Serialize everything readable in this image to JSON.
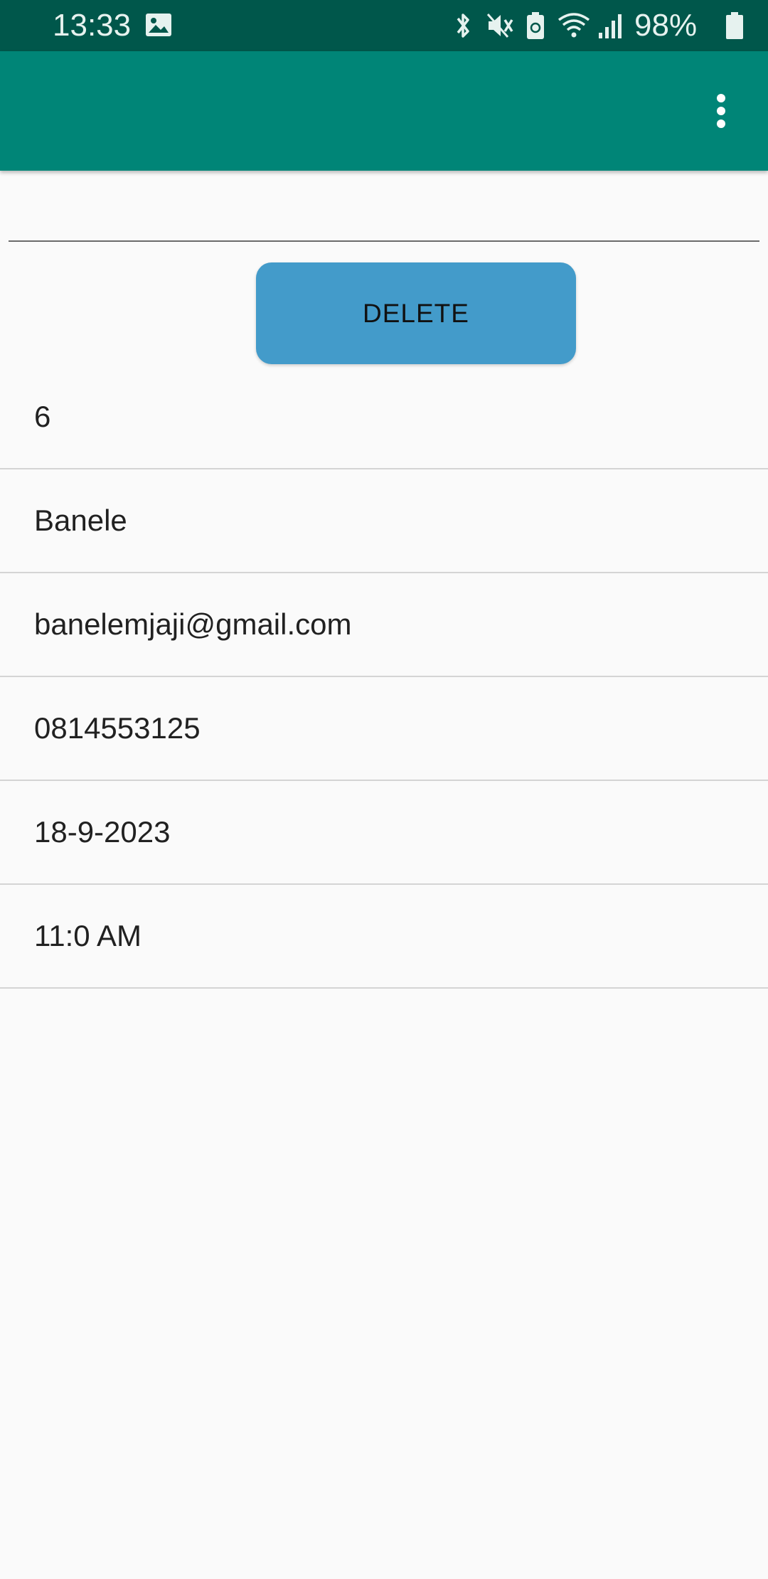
{
  "status_bar": {
    "time": "13:33",
    "battery_percent": "98%",
    "icons": [
      "gallery-icon",
      "bluetooth-icon",
      "mute-icon",
      "battery-saver-icon",
      "wifi-icon",
      "signal-icon",
      "battery-icon"
    ]
  },
  "app_bar": {
    "overflow_icon": "more-vert-icon",
    "color": "#008577"
  },
  "input": {
    "value": "",
    "placeholder": ""
  },
  "actions": {
    "delete_label": "DELETE",
    "delete_color": "#439bca"
  },
  "details": [
    "6",
    "Banele",
    "banelemjaji@gmail.com",
    "0814553125",
    "18-9-2023",
    "11:0 AM"
  ]
}
